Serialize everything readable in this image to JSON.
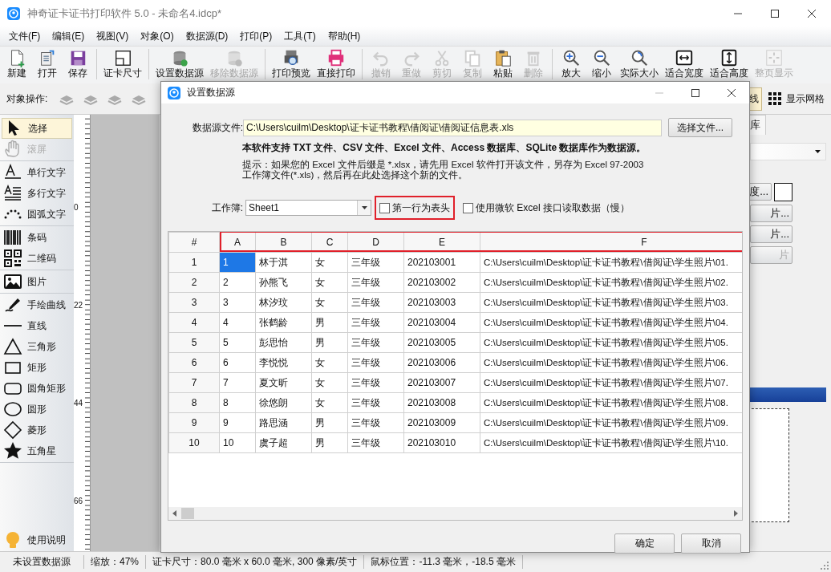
{
  "window": {
    "title": "神奇证卡证书打印软件 5.0 - 未命名4.idcp*"
  },
  "menu": [
    "文件(F)",
    "编辑(E)",
    "视图(V)",
    "对象(O)",
    "数据源(D)",
    "打印(P)",
    "工具(T)",
    "帮助(H)"
  ],
  "toolbar_groups": [
    {
      "items": [
        {
          "label": "新建",
          "disabled": false
        },
        {
          "label": "打开",
          "disabled": false
        },
        {
          "label": "保存",
          "disabled": false
        }
      ]
    },
    {
      "items": [
        {
          "label": "证卡尺寸",
          "disabled": false
        }
      ]
    },
    {
      "items": [
        {
          "label": "设置数据源",
          "disabled": false
        },
        {
          "label": "移除数据源",
          "disabled": true
        }
      ]
    },
    {
      "items": [
        {
          "label": "打印预览",
          "disabled": false
        },
        {
          "label": "直接打印",
          "disabled": false
        }
      ]
    },
    {
      "items": [
        {
          "label": "撤销",
          "disabled": true
        },
        {
          "label": "重做",
          "disabled": true
        },
        {
          "label": "剪切",
          "disabled": true
        },
        {
          "label": "复制",
          "disabled": true
        },
        {
          "label": "粘贴",
          "disabled": false
        },
        {
          "label": "删除",
          "disabled": true
        }
      ]
    },
    {
      "items": [
        {
          "label": "放大",
          "disabled": false
        },
        {
          "label": "缩小",
          "disabled": false
        },
        {
          "label": "实际大小",
          "disabled": false
        },
        {
          "label": "适合宽度",
          "disabled": false
        },
        {
          "label": "适合高度",
          "disabled": false
        },
        {
          "label": "整页显示",
          "disabled": true
        }
      ]
    }
  ],
  "object_bar": {
    "label": "对象操作:",
    "line_button": "线",
    "grid_button": "显示网格"
  },
  "toolbox": {
    "groups": [
      {
        "items": [
          {
            "label": "选择",
            "selected": true,
            "disabled": false
          },
          {
            "label": "滚屏",
            "selected": false,
            "disabled": true
          }
        ]
      },
      {
        "items": [
          {
            "label": "单行文字",
            "selected": false,
            "disabled": false
          },
          {
            "label": "多行文字",
            "selected": false,
            "disabled": false
          },
          {
            "label": "圆弧文字",
            "selected": false,
            "disabled": false
          }
        ]
      },
      {
        "items": [
          {
            "label": "条码",
            "selected": false,
            "disabled": false
          },
          {
            "label": "二维码",
            "selected": false,
            "disabled": false
          }
        ]
      },
      {
        "items": [
          {
            "label": "图片",
            "selected": false,
            "disabled": false
          }
        ]
      },
      {
        "items": [
          {
            "label": "手绘曲线",
            "selected": false,
            "disabled": false
          },
          {
            "label": "直线",
            "selected": false,
            "disabled": false
          },
          {
            "label": "三角形",
            "selected": false,
            "disabled": false
          },
          {
            "label": "矩形",
            "selected": false,
            "disabled": false
          },
          {
            "label": "圆角矩形",
            "selected": false,
            "disabled": false
          },
          {
            "label": "圆形",
            "selected": false,
            "disabled": false
          },
          {
            "label": "菱形",
            "selected": false,
            "disabled": false
          },
          {
            "label": "五角星",
            "selected": false,
            "disabled": false
          }
        ]
      }
    ],
    "help": "使用说明"
  },
  "ruler": {
    "labels": [
      "0",
      "22",
      "44",
      "66"
    ]
  },
  "right_panel": {
    "tab": "库",
    "buttons": [
      {
        "label": "度...",
        "disabled": false
      },
      {
        "label": "片...",
        "disabled": false
      },
      {
        "label": "片...",
        "disabled": false
      },
      {
        "label": "片",
        "disabled": true
      }
    ]
  },
  "dialog": {
    "title": "设置数据源",
    "file_label": "数据源文件:",
    "file_path": "C:\\Users\\cuilm\\Desktop\\证卡证书教程\\借阅证\\借阅证信息表.xls",
    "choose_button": "选择文件...",
    "support_note": "本软件支持 TXT 文件、CSV 文件、Excel 文件、Access 数据库、SQLite 数据库作为数据源。",
    "hint": [
      "提示：如果您的 Excel 文件后缀是 *.xlsx，请先用 Excel 软件打开该文件，另存为 Excel 97-2003",
      "工作簿文件(*.xls)，然后再在此处选择这个新的文件。"
    ],
    "workbook_label": "工作簿:",
    "workbook": "Sheet1",
    "checkboxes": [
      {
        "label": "第一行为表头",
        "checked": false,
        "highlighted": true
      },
      {
        "label": "使用微软 Excel 接口读取数据（慢）",
        "checked": false,
        "highlighted": false
      }
    ],
    "table": {
      "header_highlighted": true,
      "columns": [
        "#",
        "A",
        "B",
        "C",
        "D",
        "E",
        "F"
      ],
      "rows": [
        {
          "selected": true,
          "cells": [
            "1",
            "1",
            "林于淇",
            "女",
            "三年级",
            "202103001",
            "C:\\Users\\cuilm\\Desktop\\证卡证书教程\\借阅证\\学生照片\\01."
          ]
        },
        {
          "selected": false,
          "cells": [
            "2",
            "2",
            "孙熊飞",
            "女",
            "三年级",
            "202103002",
            "C:\\Users\\cuilm\\Desktop\\证卡证书教程\\借阅证\\学生照片\\02."
          ]
        },
        {
          "selected": false,
          "cells": [
            "3",
            "3",
            "林汐玟",
            "女",
            "三年级",
            "202103003",
            "C:\\Users\\cuilm\\Desktop\\证卡证书教程\\借阅证\\学生照片\\03."
          ]
        },
        {
          "selected": false,
          "cells": [
            "4",
            "4",
            "张鹤龄",
            "男",
            "三年级",
            "202103004",
            "C:\\Users\\cuilm\\Desktop\\证卡证书教程\\借阅证\\学生照片\\04."
          ]
        },
        {
          "selected": false,
          "cells": [
            "5",
            "5",
            "彭思怡",
            "男",
            "三年级",
            "202103005",
            "C:\\Users\\cuilm\\Desktop\\证卡证书教程\\借阅证\\学生照片\\05."
          ]
        },
        {
          "selected": false,
          "cells": [
            "6",
            "6",
            "李悦悦",
            "女",
            "三年级",
            "202103006",
            "C:\\Users\\cuilm\\Desktop\\证卡证书教程\\借阅证\\学生照片\\06."
          ]
        },
        {
          "selected": false,
          "cells": [
            "7",
            "7",
            "夏文昕",
            "女",
            "三年级",
            "202103007",
            "C:\\Users\\cuilm\\Desktop\\证卡证书教程\\借阅证\\学生照片\\07."
          ]
        },
        {
          "selected": false,
          "cells": [
            "8",
            "8",
            "徐悠朗",
            "女",
            "三年级",
            "202103008",
            "C:\\Users\\cuilm\\Desktop\\证卡证书教程\\借阅证\\学生照片\\08."
          ]
        },
        {
          "selected": false,
          "cells": [
            "9",
            "9",
            "路思涵",
            "男",
            "三年级",
            "202103009",
            "C:\\Users\\cuilm\\Desktop\\证卡证书教程\\借阅证\\学生照片\\09."
          ]
        },
        {
          "selected": false,
          "cells": [
            "10",
            "10",
            "虞子超",
            "男",
            "三年级",
            "202103010",
            "C:\\Users\\cuilm\\Desktop\\证卡证书教程\\借阅证\\学生照片\\10."
          ]
        }
      ]
    },
    "buttons": [
      "确定",
      "取消"
    ]
  },
  "status_bar": [
    "未设置数据源",
    "缩放：47%",
    "证卡尺寸：80.0 毫米 x 60.0 毫米, 300 像素/英寸",
    "鼠标位置：-11.3 毫米，-18.5 毫米"
  ]
}
